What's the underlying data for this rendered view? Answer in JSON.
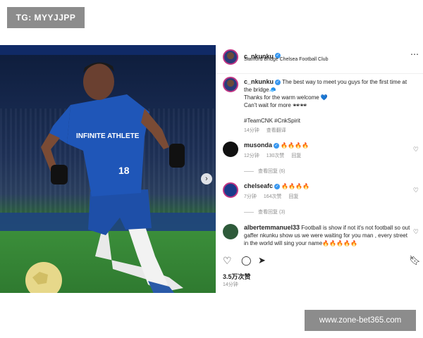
{
  "watermark_top": "TG: MYYJJPP",
  "watermark_bottom": "www.zone-bet365.com",
  "photo": {
    "jersey_sponsor": "INFINITE ATHLETE",
    "number": "18"
  },
  "header": {
    "username": "c_nkunku",
    "location": "Stanford Bridge Chelsea Football Club",
    "more_icon": "⋯"
  },
  "caption": {
    "username": "c_nkunku",
    "line1": "The best way to meet you guys for the first time at",
    "line2": "the bridge🧢",
    "line3": "Thanks for the warm welcome 💙",
    "line4": "Can't wait for more 🕶🕶",
    "hashtags": "#TeamCNK #CnkSpirit",
    "time": "14分钟",
    "translate": "查看翻译"
  },
  "comments": [
    {
      "username": "musonda",
      "text": "🔥🔥🔥🔥",
      "time": "12分钟",
      "likes": "130次赞",
      "reply": "回复",
      "view_replies": "查看回复 (6)",
      "avatar_color": "#111111"
    },
    {
      "username": "chelseafc",
      "text": "🔥🔥🔥🔥",
      "time": "7分钟",
      "likes": "164次赞",
      "reply": "回复",
      "view_replies": "查看回复 (3)",
      "avatar_color": "#1a3a8a"
    },
    {
      "username": "albertemmanuel33",
      "text": "Football is show if not it's not football so out gaffer nkunku show us we were waiting for you man , every street in the world will sing your name🔥🔥🔥🔥🔥",
      "avatar_color": "#2e5a3a"
    }
  ],
  "likes": "3.5万次赞",
  "post_time": "14分钟",
  "icons": {
    "like": "heart-icon",
    "comment": "comment-icon",
    "share": "send-icon",
    "save": "bookmark-icon"
  }
}
